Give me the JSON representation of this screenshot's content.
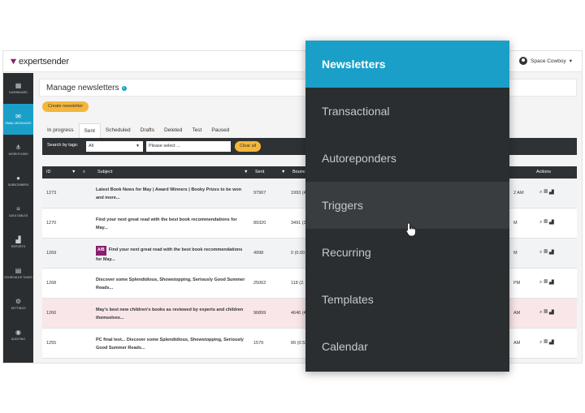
{
  "brand": {
    "logo_text": "expertsender",
    "accent": "#1aa0c8",
    "highlight": "#f4b63b"
  },
  "user": {
    "name": "Space Cowboy",
    "caret": "▾"
  },
  "sidebar": {
    "items": [
      {
        "label": "DASHBOARD",
        "icon": "dashboard-icon"
      },
      {
        "label": "EMAIL MESSAGES",
        "icon": "mail-icon"
      },
      {
        "label": "WORKFLOWS",
        "icon": "workflow-icon"
      },
      {
        "label": "SUBSCRIBERS",
        "icon": "user-icon"
      },
      {
        "label": "DATA TABLES",
        "icon": "database-icon"
      },
      {
        "label": "REPORTS",
        "icon": "chart-icon"
      },
      {
        "label": "SCHEDULED TASKS",
        "icon": "calendar-icon"
      },
      {
        "label": "SETTINGS",
        "icon": "gear-icon"
      },
      {
        "label": "AUDITING",
        "icon": "eye-icon"
      }
    ]
  },
  "page": {
    "title": "Manage newsletters",
    "info": "i"
  },
  "create_button": "Create newsletter",
  "tabs": [
    "In progress",
    "Sent",
    "Scheduled",
    "Drafts",
    "Deleted",
    "Test",
    "Paused"
  ],
  "filter": {
    "label": "Search by tags:",
    "select_value": "All",
    "placeholder": "Please select ...",
    "clear_label": "Clear all"
  },
  "table": {
    "headers": {
      "id": "ID",
      "subject": "Subject",
      "sent": "Sent",
      "bounces": "Bounces",
      "actions": "Actions"
    },
    "rows": [
      {
        "id": "1273",
        "subject": "Latest Book News for May | Award Winners | Booky Prizes to be won and more...",
        "sent": "97907",
        "bounces": "1993 (4.",
        "time": "2 AM",
        "ab": ""
      },
      {
        "id": "1270",
        "subject": "Find your next great read with the best book recommendations for May...",
        "sent": "89320",
        "bounces": "3491 (3.",
        "time": "M",
        "ab": ""
      },
      {
        "id": "1269",
        "subject": "Find your next great read with the best book recommendations for May...",
        "sent": "4998",
        "bounces": "0 (0.00",
        "time": "M",
        "ab": "A/B"
      },
      {
        "id": "1268",
        "subject": "Discover some Splendidious, Showstopping, Seriously Good Summer Reads...",
        "sent": "25062",
        "bounces": "118 (2.",
        "time": "PM",
        "ab": ""
      },
      {
        "id": "1260",
        "subject": "May's best new children's books as reviewed by experts and children themselves...",
        "sent": "96899",
        "bounces": "4646 (4.",
        "time": "AM",
        "ab": ""
      },
      {
        "id": "1255",
        "subject": "PC final test... Discover some Splendidious, Showstopping, Seriously Good Summer Reads...",
        "sent": "1579",
        "bounces": "89 (0.52",
        "time": "AM",
        "ab": ""
      }
    ]
  },
  "dropdown_menu": {
    "items": [
      {
        "label": "Newsletters",
        "state": "active"
      },
      {
        "label": "Transactional",
        "state": ""
      },
      {
        "label": "Autoreponders",
        "state": ""
      },
      {
        "label": "Triggers",
        "state": "hover"
      },
      {
        "label": "Recurring",
        "state": ""
      },
      {
        "label": "Templates",
        "state": ""
      },
      {
        "label": "Calendar",
        "state": ""
      }
    ]
  }
}
